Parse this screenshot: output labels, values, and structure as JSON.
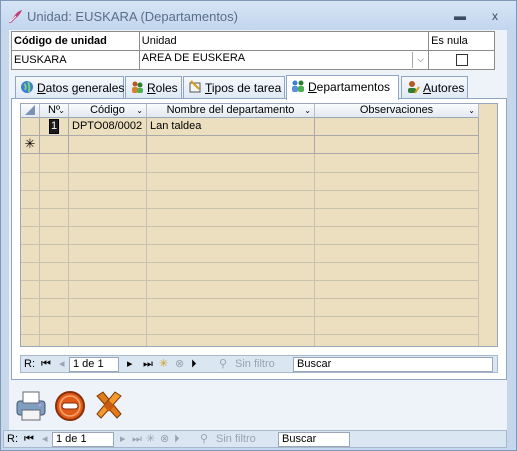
{
  "window": {
    "title": "Unidad: EUSKARA (Departamentos)",
    "minimize_glyph": "▬",
    "close_glyph": "x",
    "app_icon": "quill-icon"
  },
  "header": {
    "col_code_label": "Código de unidad",
    "col_unit_label": "Unidad",
    "col_null_label": "Es nula",
    "code_value": "EUSKARA",
    "unit_value": "AREA DE EUSKERA",
    "unit_dropdown_glyph": "⌵",
    "is_null_checked": false
  },
  "tabs": [
    {
      "label": "Datos generales",
      "underline": "D",
      "icon": "globe-icon",
      "active": false
    },
    {
      "label": "Roles",
      "underline": "R",
      "icon": "people-icon",
      "active": false
    },
    {
      "label": "Tipos de tarea",
      "underline": "T",
      "icon": "task-icon",
      "active": false
    },
    {
      "label": "Departamentos",
      "underline": "D",
      "icon": "departments-icon",
      "active": true
    },
    {
      "label": "Autores",
      "underline": "A",
      "icon": "author-icon",
      "active": false
    }
  ],
  "grid": {
    "columns": [
      {
        "label": "Nº",
        "sortable": true
      },
      {
        "label": "Código",
        "sortable": true
      },
      {
        "label": "Nombre del departamento",
        "sortable": true
      },
      {
        "label": "Observaciones",
        "sortable": true
      }
    ],
    "rows": [
      {
        "num": "1",
        "code": "DPTO08/0002",
        "name": "Lan taldea",
        "notes": ""
      }
    ],
    "new_row_marker": "✳"
  },
  "grid_nav": {
    "record_label": "R:",
    "position": "1 de 1",
    "filter_label": "Sin filtro",
    "search_placeholder": "Buscar"
  },
  "form_nav": {
    "record_label": "R:",
    "position": "1 de 1",
    "filter_label": "Sin filtro",
    "search_placeholder": "Buscar"
  },
  "actions": [
    {
      "name": "print-button",
      "icon": "printer-icon"
    },
    {
      "name": "remove-button",
      "icon": "minus-circle-icon"
    },
    {
      "name": "tools-button",
      "icon": "tools-icon"
    }
  ]
}
